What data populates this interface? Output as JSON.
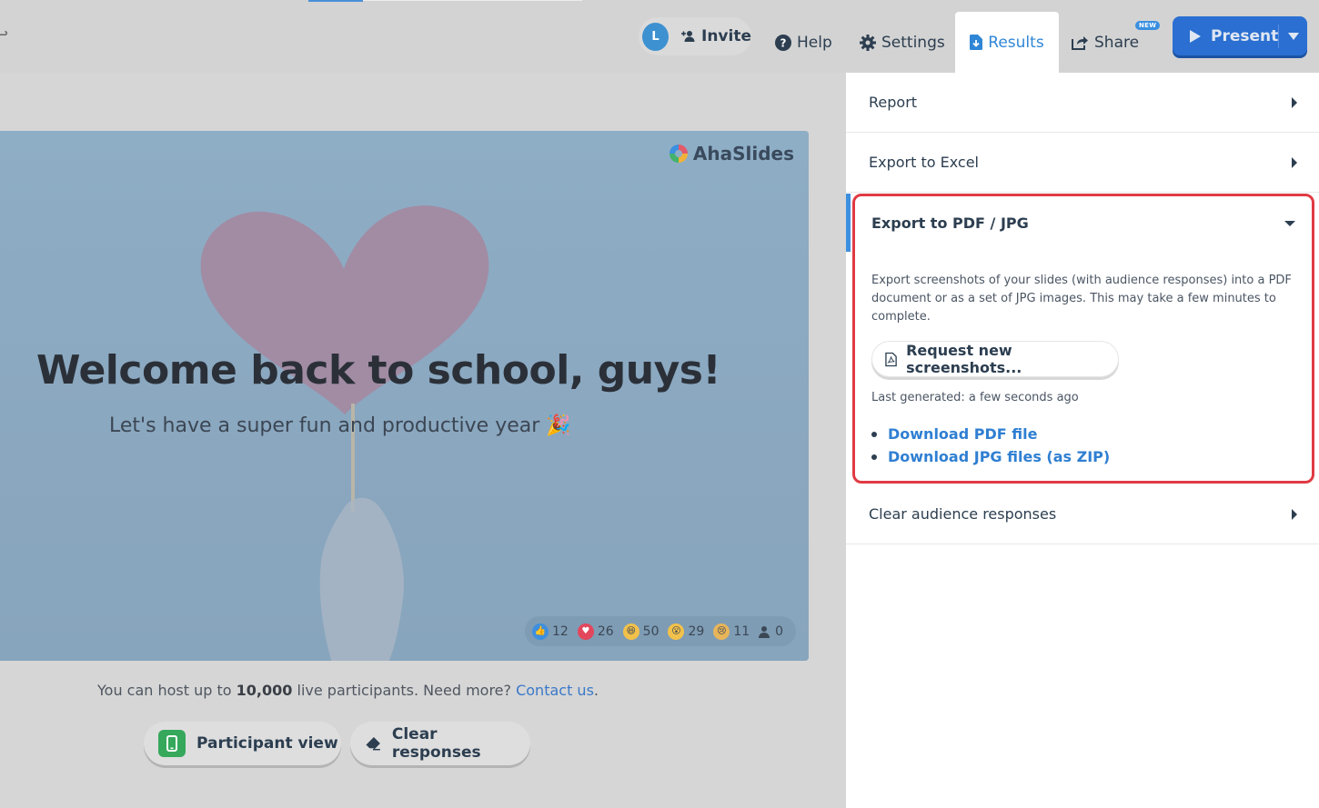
{
  "toolbar": {
    "avatar_initial": "L",
    "invite_label": "Invite",
    "help_label": "Help",
    "settings_label": "Settings",
    "results_label": "Results",
    "share_label": "Share",
    "new_badge": "NEW",
    "present_label": "Present"
  },
  "slide": {
    "brand": "AhaSlides",
    "title": "Welcome back to school, guys!",
    "subtitle": "Let's have a super fun and productive year 🎉",
    "reactions": [
      {
        "icon": "thumbs-up-icon",
        "count": "12"
      },
      {
        "icon": "heart-icon",
        "count": "26"
      },
      {
        "icon": "laugh-icon",
        "count": "50"
      },
      {
        "icon": "surprised-icon",
        "count": "29"
      },
      {
        "icon": "sad-icon",
        "count": "11"
      },
      {
        "icon": "participants-icon",
        "count": "0"
      }
    ]
  },
  "host": {
    "prefix": "You can host up to ",
    "limit": "10,000",
    "middle": " live participants. Need more? ",
    "contact_link": "Contact us",
    "suffix": "."
  },
  "footer": {
    "participant_view": "Participant view",
    "clear_responses": "Clear responses"
  },
  "panel": {
    "report": "Report",
    "export_excel": "Export to Excel",
    "export_pdf": {
      "title": "Export to PDF / JPG",
      "description": "Export screenshots of your slides (with audience responses) into a PDF document or as a set of JPG images. This may take a few minutes to complete.",
      "request_button": "Request new screenshots...",
      "last_generated": "Last generated: a few seconds ago",
      "download_pdf": "Download PDF file",
      "download_jpg": "Download JPG files (as ZIP)"
    },
    "clear_audience": "Clear audience responses"
  },
  "colors": {
    "accent": "#2f86d6",
    "present": "#2a6fd1",
    "highlight_border": "#e03b44",
    "participant_green": "#35a85c"
  }
}
